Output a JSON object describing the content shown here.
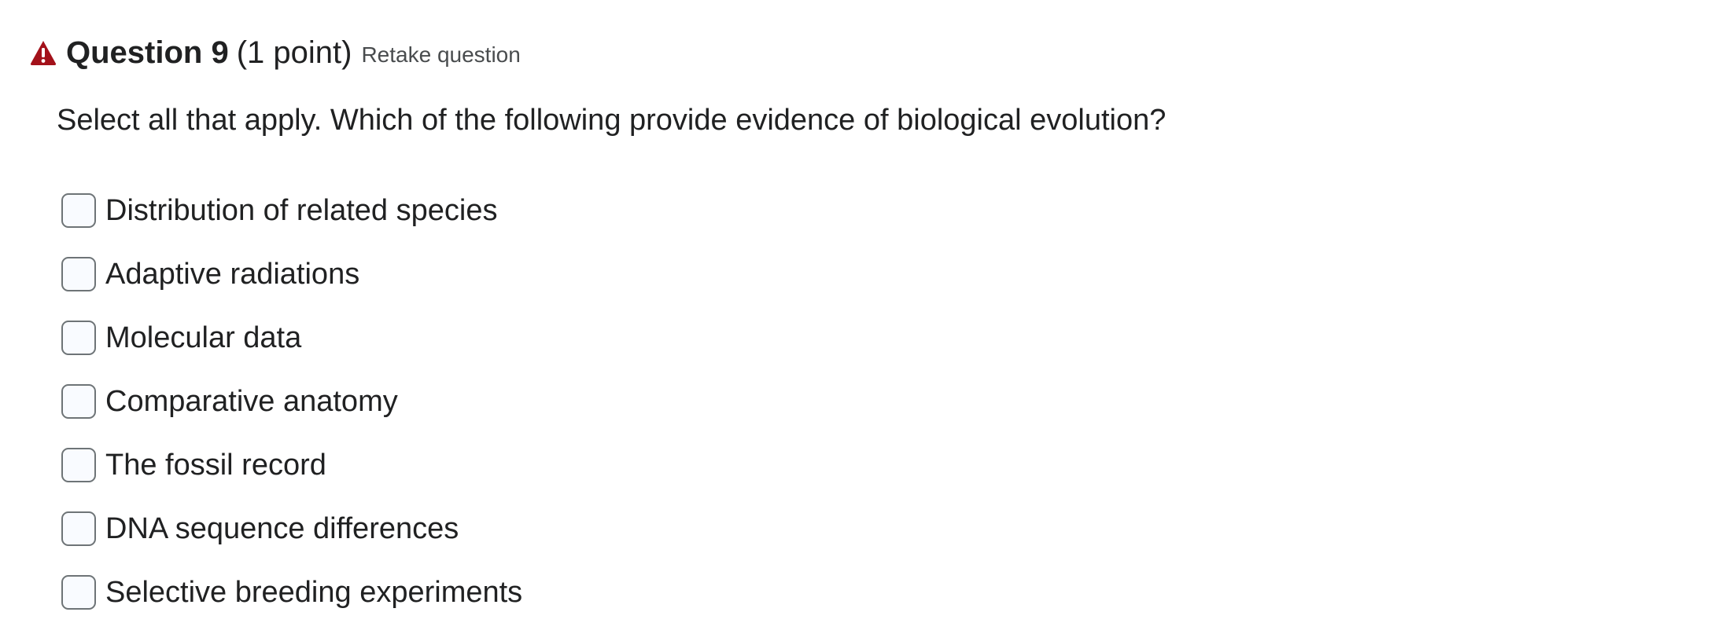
{
  "question": {
    "title": "Question 9",
    "points": "(1 point)",
    "retake_label": "Retake question",
    "prompt": "Select all that apply. Which of the following provide evidence of biological evolution?",
    "status_icon": "warning-icon",
    "status_color": "#a3111a",
    "options": [
      {
        "label": "Distribution of related species",
        "checked": false
      },
      {
        "label": "Adaptive radiations",
        "checked": false
      },
      {
        "label": "Molecular data",
        "checked": false
      },
      {
        "label": "Comparative anatomy",
        "checked": false
      },
      {
        "label": "The fossil record",
        "checked": false
      },
      {
        "label": "DNA sequence differences",
        "checked": false
      },
      {
        "label": "Selective breeding experiments",
        "checked": false
      }
    ]
  }
}
